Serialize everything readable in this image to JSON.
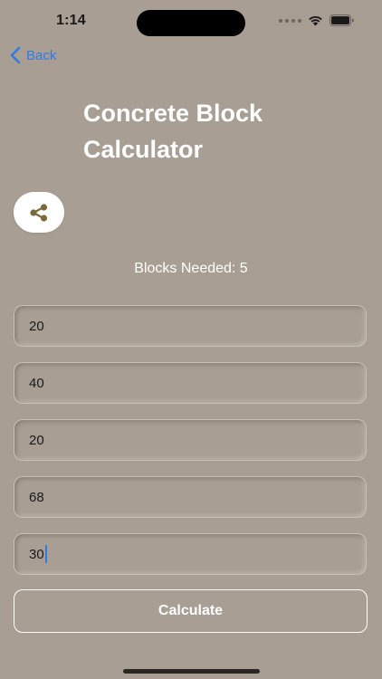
{
  "status_bar": {
    "time": "1:14"
  },
  "nav": {
    "back_label": "Back"
  },
  "title": "Concrete Block Calculator",
  "result": {
    "text": "Blocks Needed: 5"
  },
  "fields": [
    {
      "value": "20"
    },
    {
      "value": "40"
    },
    {
      "value": "20"
    },
    {
      "value": "68"
    },
    {
      "value": "30"
    }
  ],
  "calculate_label": "Calculate",
  "colors": {
    "background": "#a89e93",
    "accent": "#2f7be5",
    "share_icon": "#7a6a3a",
    "text": "#ffffff"
  },
  "icons": {
    "back": "chevron-left-icon",
    "share": "share-icon",
    "wifi": "wifi-icon",
    "battery": "battery-icon"
  }
}
